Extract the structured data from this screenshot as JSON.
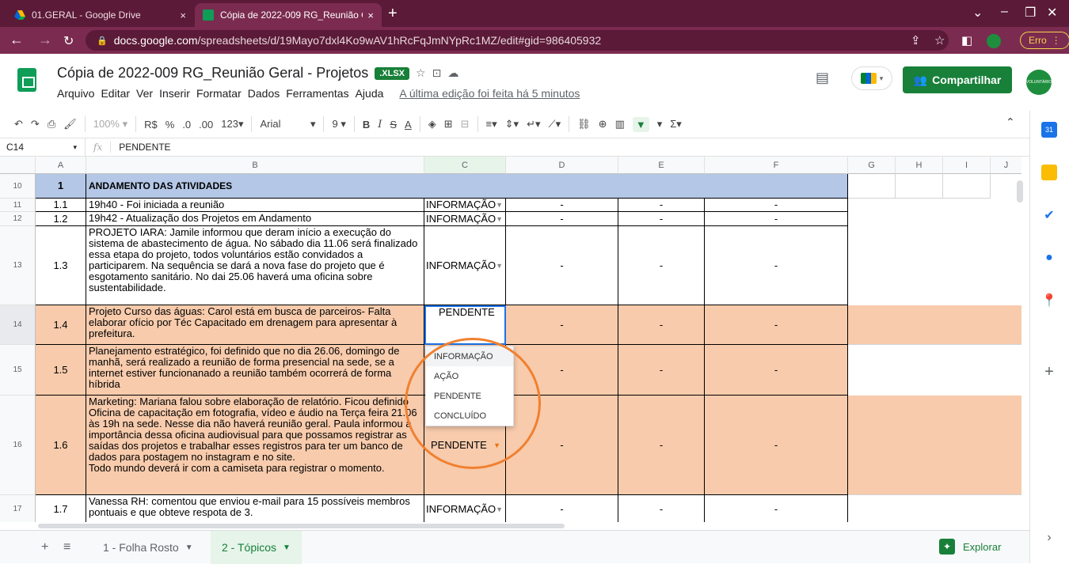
{
  "browser": {
    "tabs": [
      {
        "title": "01.GERAL - Google Drive",
        "close": "×"
      },
      {
        "title": "Cópia de 2022-009 RG_Reunião G",
        "close": "×"
      }
    ],
    "new_tab": "+",
    "url_host": "docs.google.com",
    "url_path": "/spreadsheets/d/19Mayo7dxl4Ko9wAV1hRcFqJmNYpRc1MZ/edit#gid=986405932",
    "error_label": "Erro"
  },
  "doc": {
    "title": "Cópia de 2022-009 RG_Reunião Geral - Projetos",
    "badge": ".XLSX",
    "menus": [
      "Arquivo",
      "Editar",
      "Ver",
      "Inserir",
      "Formatar",
      "Dados",
      "Ferramentas",
      "Ajuda"
    ],
    "last_edit": "A última edição foi feita há 5 minutos",
    "share_label": "Compartilhar",
    "avatar_text": "VOLUNTÁRIO"
  },
  "toolbar": {
    "zoom": "100%",
    "currency": "R$",
    "percent": "%",
    "dec_less": ".0",
    "dec_more": ".00",
    "format123": "123",
    "font": "Arial",
    "size": "9"
  },
  "formula": {
    "cell_ref": "C14",
    "fx": "fx",
    "value": "PENDENTE"
  },
  "columns": [
    "A",
    "B",
    "C",
    "D",
    "E",
    "F",
    "G",
    "H",
    "I",
    "J"
  ],
  "rows": [
    {
      "num": "10",
      "a": "1",
      "b": "ANDAMENTO DAS ATIVIDADES",
      "c": "",
      "d": "",
      "e": "",
      "f": ""
    },
    {
      "num": "11",
      "a": "1.1",
      "b": "19h40 - Foi iniciada a reunião",
      "c": "INFORMAÇÃO",
      "d": "-",
      "e": "-",
      "f": "-"
    },
    {
      "num": "12",
      "a": "1.2",
      "b": "19h42 - Atualização dos Projetos em Andamento",
      "c": "INFORMAÇÃO",
      "d": "-",
      "e": "-",
      "f": "-"
    },
    {
      "num": "13",
      "a": "1.3",
      "b": "PROJETO IARA: Jamile informou que deram início a execução do sistema de abastecimento de água. No sábado dia 11.06 será finalizado essa etapa do projeto, todos voluntários estão convidados a participarem. Na sequência se dará a nova fase do projeto que é esgotamento sanitário. No dai 25.06 haverá uma oficina sobre sustentabilidade.",
      "c": "INFORMAÇÃO",
      "d": "-",
      "e": "-",
      "f": "-"
    },
    {
      "num": "14",
      "a": "1.4",
      "b": "Projeto Curso das águas: Carol está em busca de parceiros- Falta elaborar ofício por Téc Capacitado em drenagem para apresentar à prefeitura.",
      "c": "PENDENTE",
      "d": "-",
      "e": "-",
      "f": "-"
    },
    {
      "num": "15",
      "a": "1.5",
      "b": "Planejamento estratégico, foi definido que no dia 26.06, domingo de manhã, será realizado a reunião de forma presencial na sede, se a internet estiver funcionanado a reunião também ocorrerá de forma híbrida",
      "c": "",
      "d": "-",
      "e": "-",
      "f": "-"
    },
    {
      "num": "16",
      "a": "1.6",
      "b": "Marketing: Mariana falou sobre elaboração de relatório. Ficou definido Oficina de capacitação em fotografia, vídeo e áudio na Terça feira 21.06 às 19h na sede. Nesse dia não haverá reunião geral. Paula informou a importância dessa oficina audiovisual para que possamos registrar as saídas dos projetos e trabalhar esses registros para ter um banco de dados para postagem no instagram e no site.",
      "b2": "Todo mundo deverá ir com a camiseta para registrar o momento.",
      "c": "PENDENTE",
      "d": "-",
      "e": "-",
      "f": "-"
    },
    {
      "num": "17",
      "a": "1.7",
      "b": "Vanessa RH: comentou que enviou e-mail para 15 possíveis membros pontuais e que obteve respota de 3.",
      "c": "INFORMAÇÃO",
      "d": "-",
      "e": "-",
      "f": "-"
    }
  ],
  "dropdown_options": [
    "INFORMAÇÃO",
    "AÇÃO",
    "PENDENTE",
    "CONCLUÍDO"
  ],
  "sheets": {
    "add": "+",
    "list": "≡",
    "tabs": [
      {
        "label": "1 - Folha Rosto"
      },
      {
        "label": "2 - Tópicos"
      }
    ],
    "explore_label": "Explorar"
  },
  "colors": {
    "header_blue": "#b4c7e7",
    "pending_orange": "#f7cbac",
    "accent_green": "#188038",
    "circle_orange": "#f08030"
  }
}
